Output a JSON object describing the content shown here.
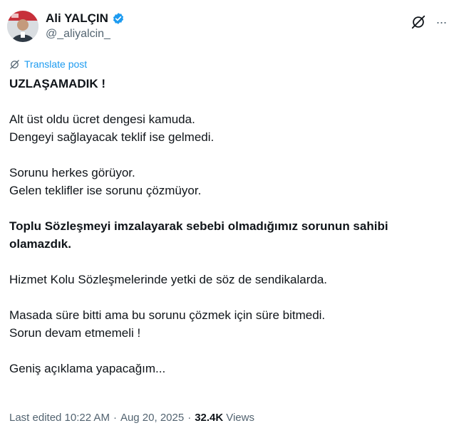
{
  "author": {
    "display_name": "Ali YALÇIN",
    "handle": "@_aliyalcin_",
    "verified": true
  },
  "actions": {
    "grok_icon": "grok-icon",
    "more_icon": "more-icon",
    "more_label": "···"
  },
  "translate": {
    "label": "Translate post",
    "icon": "translate-icon"
  },
  "post": {
    "line_1": "UZLAŞAMADIK !",
    "line_2": "Alt üst oldu ücret dengesi kamuda.",
    "line_3": "Dengeyi sağlayacak teklif ise gelmedi.",
    "line_4": "Sorunu herkes görüyor.",
    "line_5": "Gelen teklifler ise sorunu çözmüyor.",
    "line_6": "Toplu Sözleşmeyi imzalayarak sebebi olmadığımız sorunun sahibi",
    "line_7": "olamazdık.",
    "line_8": "Hizmet Kolu Sözleşmelerinde yetki de söz de sendikalarda.",
    "line_9": "Masada süre bitti ama bu sorunu çözmek için süre bitmedi.",
    "line_10": "Sorun devam etmemeli !",
    "line_11": "Geniş açıklama yapacağım..."
  },
  "footer": {
    "edited": "Last edited 10:22 AM",
    "separator": "·",
    "date": "Aug 20, 2025",
    "views_count": "32.4K",
    "views_label": "Views"
  },
  "colors": {
    "text": "#0f1419",
    "secondary": "#536471",
    "accent": "#1d9bf0"
  }
}
